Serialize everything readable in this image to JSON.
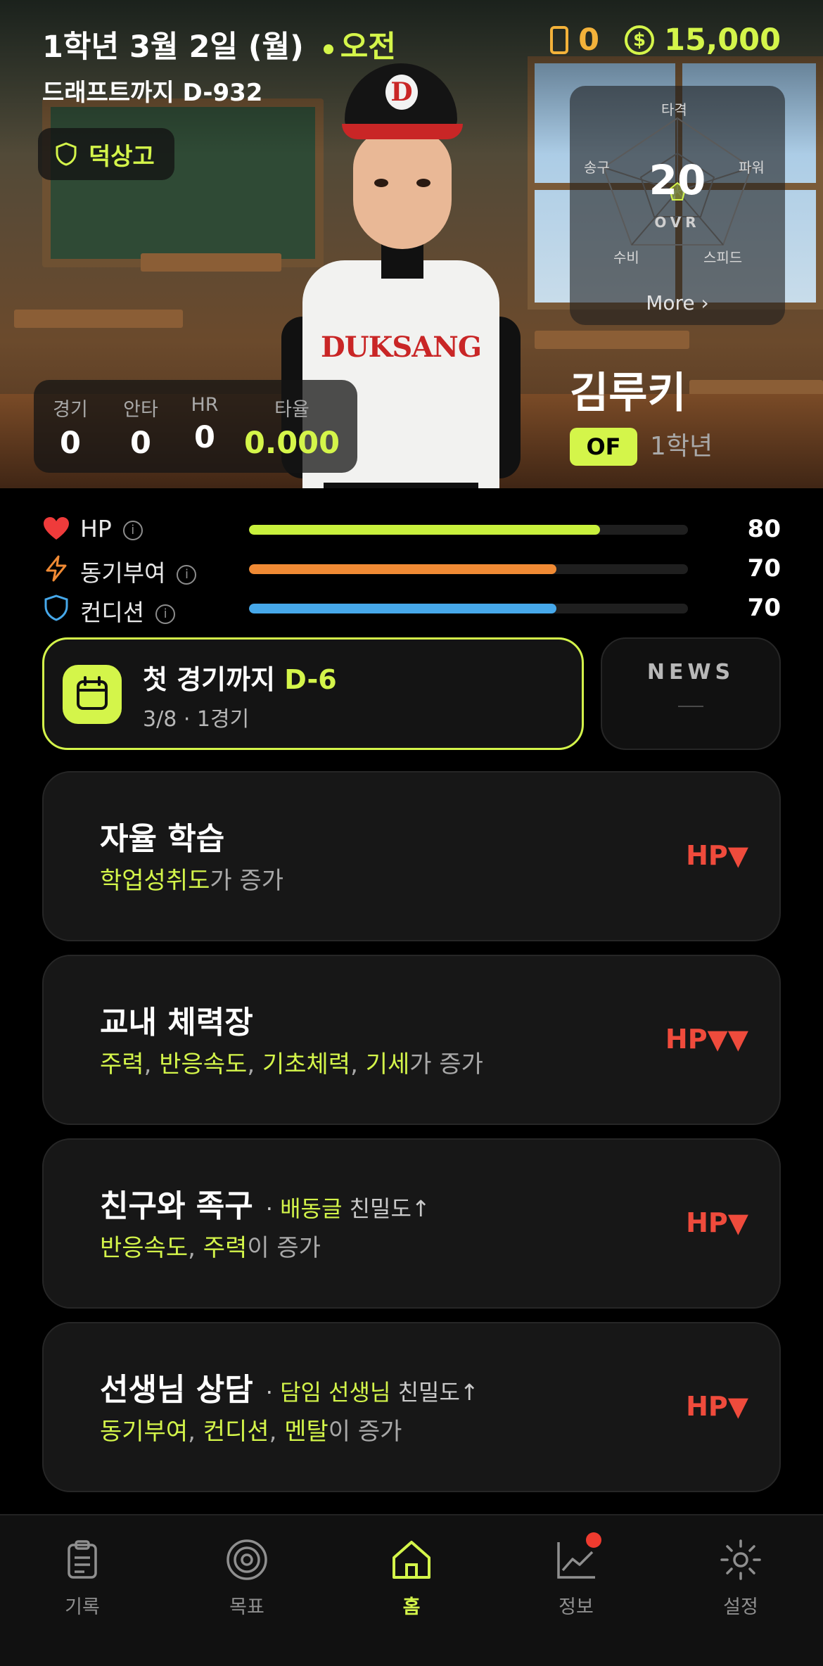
{
  "header": {
    "date": "1학년 3월 2일 (월)",
    "time_of_day": "오전",
    "draft_countdown": "드래프트까지 D-932",
    "school_name": "덕상고",
    "phone_count": "0",
    "money": "15,000",
    "accent_color": "#d4f54a"
  },
  "ovr_card": {
    "stat_labels": {
      "top": "타격",
      "left": "송구",
      "right": "파워",
      "bottom_left": "수비",
      "bottom_right": "스피드"
    },
    "ovr_value": "20",
    "ovr_label": "OVR",
    "more_label": "More ›"
  },
  "season_record": {
    "columns": [
      {
        "label": "경기",
        "value": "0"
      },
      {
        "label": "안타",
        "value": "0"
      },
      {
        "label": "HR",
        "value": "0"
      },
      {
        "label": "타율",
        "value": "0.000"
      }
    ]
  },
  "player": {
    "name": "김루키",
    "position": "OF",
    "grade": "1학년",
    "cap_letter": "D",
    "jersey_text": "DUKSANG"
  },
  "stats": [
    {
      "label": "HP",
      "value": "80",
      "level": 0.8,
      "color": "#c8f03c"
    },
    {
      "label": "동기부여",
      "value": "70",
      "level": 0.7,
      "color": "#f08a34"
    },
    {
      "label": "컨디션",
      "value": "70",
      "level": 0.7,
      "color": "#46a8ea"
    }
  ],
  "info_glyph": "i",
  "next_game": {
    "title_prefix": "첫 경기까지",
    "title_dday": "D-6",
    "subtitle": "3/8 · 1경기"
  },
  "news": {
    "label": "NEWS"
  },
  "activities": [
    {
      "title": "자율 학습",
      "note_target": "",
      "note_rest": "",
      "desc_highlight": "학업성취도",
      "desc_rest": "가 증가",
      "hp_cost": "HP▼"
    },
    {
      "title": "교내 체력장",
      "note_target": "",
      "note_rest": "",
      "desc_highlight": "주력",
      "desc_highlight_2": "반응속도",
      "desc_highlight_3": "기초체력",
      "desc_highlight_4": "기세",
      "desc_rest": "가 증가",
      "hp_cost": "HP▼▼"
    },
    {
      "title": "친구와 족구",
      "note_sep": "·",
      "note_target": "배동글",
      "note_rest": "친밀도↑",
      "desc_highlight": "반응속도",
      "desc_highlight_2": "주력",
      "desc_rest": "이 증가",
      "hp_cost": "HP▼"
    },
    {
      "title": "선생님 상담",
      "note_sep": "·",
      "note_target": "담임 선생님",
      "note_rest": "친밀도↑",
      "desc_highlight": "동기부여",
      "desc_highlight_2": "컨디션",
      "desc_highlight_3": "멘탈",
      "desc_rest": "이 증가",
      "hp_cost": "HP▼"
    }
  ],
  "separator": ", ",
  "tabbar": [
    {
      "label": "기록",
      "icon": "clipboard-icon",
      "active": false
    },
    {
      "label": "목표",
      "icon": "target-icon",
      "active": false
    },
    {
      "label": "홈",
      "icon": "home-icon",
      "active": true
    },
    {
      "label": "정보",
      "icon": "chart-line-icon",
      "active": false,
      "has_badge": true
    },
    {
      "label": "설정",
      "icon": "gear-icon",
      "active": false
    }
  ]
}
